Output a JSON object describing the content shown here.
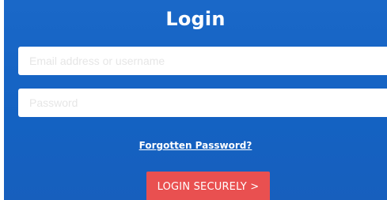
{
  "login": {
    "title": "Login",
    "username_placeholder": "Email address or username",
    "password_placeholder": "Password",
    "forgot_password_label": "Forgotten Password?",
    "submit_label": "LOGIN SECURELY >"
  },
  "colors": {
    "panel_background": "#1565c6",
    "submit_button": "#e95050",
    "text": "#ffffff"
  }
}
